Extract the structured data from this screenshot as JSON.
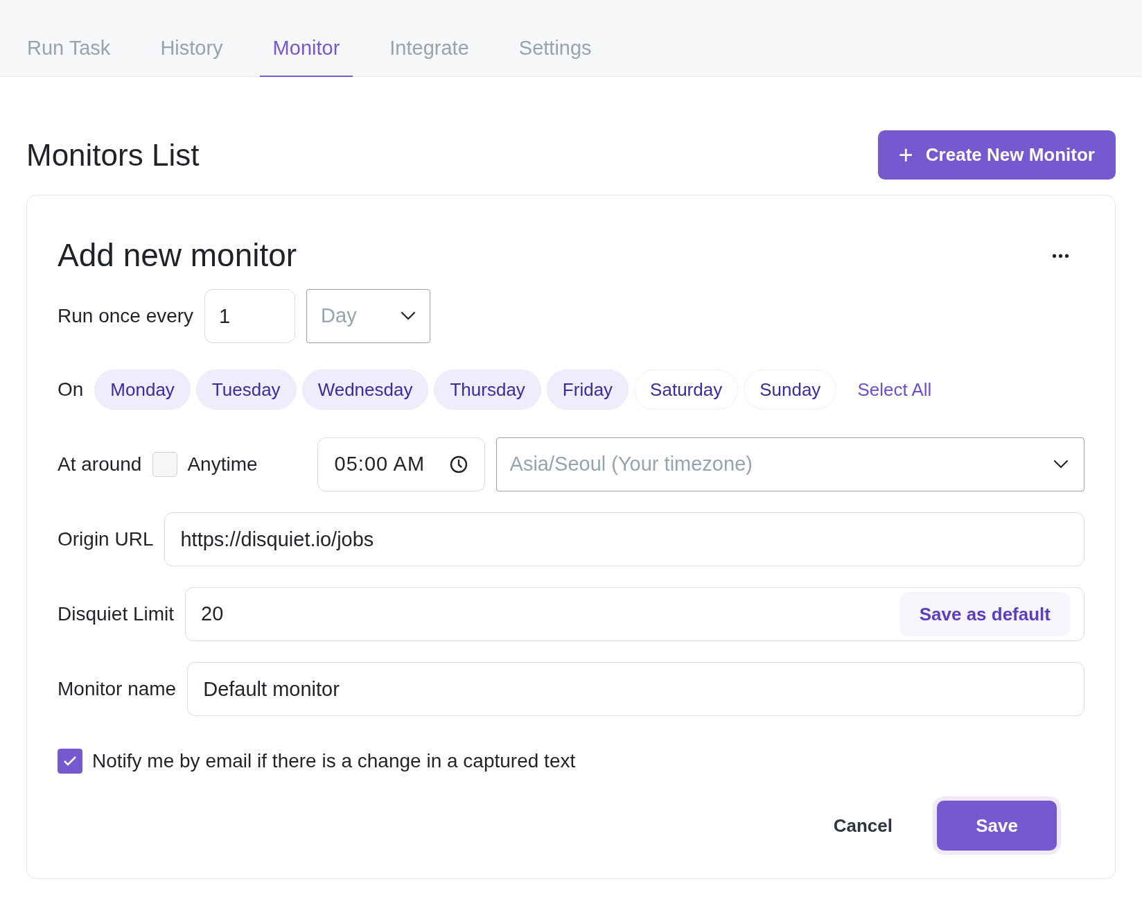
{
  "tabs": [
    {
      "label": "Run Task",
      "selected": false
    },
    {
      "label": "History",
      "selected": false
    },
    {
      "label": "Monitor",
      "selected": true
    },
    {
      "label": "Integrate",
      "selected": false
    },
    {
      "label": "Settings",
      "selected": false
    }
  ],
  "page_title": "Monitors List",
  "create_button": {
    "icon": "+",
    "label": "Create New Monitor"
  },
  "form": {
    "title": "Add new monitor",
    "menu_icon": "•••",
    "run_once_every": {
      "label": "Run once every",
      "value": "1",
      "unit_placeholder": "Day"
    },
    "days": {
      "label": "On",
      "items": [
        {
          "label": "Monday",
          "selected": true
        },
        {
          "label": "Tuesday",
          "selected": true
        },
        {
          "label": "Wednesday",
          "selected": true
        },
        {
          "label": "Thursday",
          "selected": true
        },
        {
          "label": "Friday",
          "selected": true
        },
        {
          "label": "Saturday",
          "selected": false
        },
        {
          "label": "Sunday",
          "selected": false
        }
      ],
      "select_all": "Select All"
    },
    "at_around": {
      "label": "At around",
      "anytime": {
        "label": "Anytime",
        "checked": false
      },
      "time": "05:00 AM",
      "timezone_placeholder": "Asia/Seoul (Your timezone)"
    },
    "origin_url": {
      "label": "Origin URL",
      "value": "https://disquiet.io/jobs"
    },
    "disquiet_limit": {
      "label": "Disquiet Limit",
      "value": "20",
      "save_default": "Save as default"
    },
    "monitor_name": {
      "label": "Monitor name",
      "value": "Default monitor"
    },
    "notify": {
      "label": "Notify me by email if there is a change in a captured text",
      "checked": true
    },
    "cancel": "Cancel",
    "save": "Save"
  }
}
